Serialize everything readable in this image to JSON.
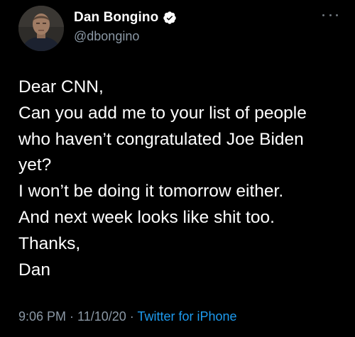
{
  "author": {
    "display_name": "Dan Bongino",
    "handle": "@dbongino",
    "verified": true,
    "avatar_icon": "avatar-photo"
  },
  "tweet": {
    "lines": [
      "Dear CNN,",
      "Can you add me to your list of people",
      "who haven’t congratulated Joe Biden",
      "yet?",
      "I won’t be doing it tomorrow either.",
      "And next week looks like shit too.",
      "Thanks,",
      "Dan"
    ]
  },
  "meta": {
    "time": "9:06 PM",
    "separator": " · ",
    "date": "11/10/20",
    "source": "Twitter for iPhone"
  },
  "icons": {
    "verified": "verified-badge-icon",
    "more": "more-options-icon"
  },
  "colors": {
    "background": "#000000",
    "text": "#ffffff",
    "secondary": "#8b98a5",
    "link": "#1d9bf0"
  }
}
